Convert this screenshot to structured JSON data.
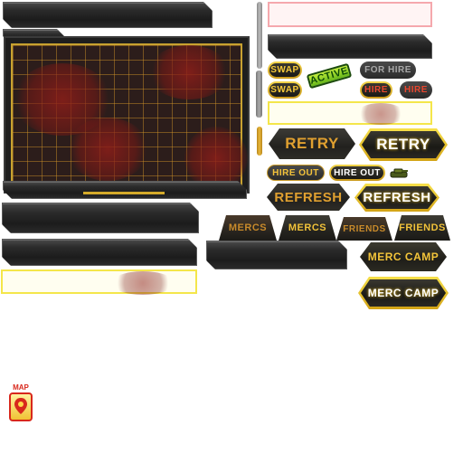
{
  "map_icon": {
    "label": "MAP",
    "icon": "map-marker-icon"
  },
  "buttons": {
    "swap": "SWAP",
    "swap_active": "SWAP",
    "active": "ACTIVE",
    "for_hire": "FOR HIRE",
    "hire_active": "HIRE",
    "hire": "HIRE",
    "retry": "RETRY",
    "retry_active": "RETRY",
    "hire_out": "HIRE OUT",
    "hire_out_active": "HIRE OUT",
    "refresh": "REFRESH",
    "refresh_active": "REFRESH",
    "mercs": "MERCS",
    "mercs_active": "MERCS",
    "friends": "FRIENDS",
    "friends_active": "FRIENDS",
    "merc_camp": "MERC CAMP",
    "merc_camp_active": "MERC CAMP"
  },
  "colors": {
    "gold": "#f4d040",
    "orange_text": "#e0a030",
    "dark_panel": "#1e1e1e",
    "blood": "#8c1e19"
  }
}
